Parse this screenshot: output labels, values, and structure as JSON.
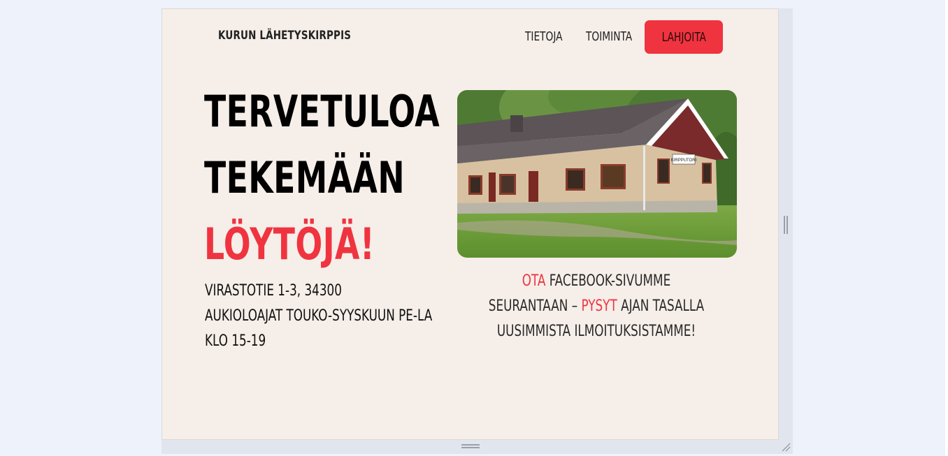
{
  "nav": {
    "brand": "KURUN LÄHETYSKIRPPIS",
    "links": [
      "TIETOJA",
      "TOIMINTA"
    ],
    "donate_label": "LAHJOITA"
  },
  "hero": {
    "line1": "TERVETULOA",
    "line2": "TEKEMÄÄN",
    "line3": "LÖYTÖJÄ!"
  },
  "info": {
    "address": "VIRASTOTIE 1-3, 34300",
    "hours_line1": "AUKIOLOAJAT TOUKO-SYYSKUUN PE-LA",
    "hours_line2": "KLO 15-19"
  },
  "photo": {
    "sign_text": "KIRPPUTORI"
  },
  "facebook": {
    "w1": "OTA",
    "w2": "FACEBOOK-SIVUMME",
    "w3": "SEURANTAAN –",
    "w4": "PYSYT",
    "w5": "AJAN TASALLA",
    "w6": "UUSIMMISTA ILMOITUKSISTAMME!"
  },
  "colors": {
    "accent": "#ef3440",
    "page_bg": "#f6eee8",
    "outer_bg": "#eef2fa"
  }
}
